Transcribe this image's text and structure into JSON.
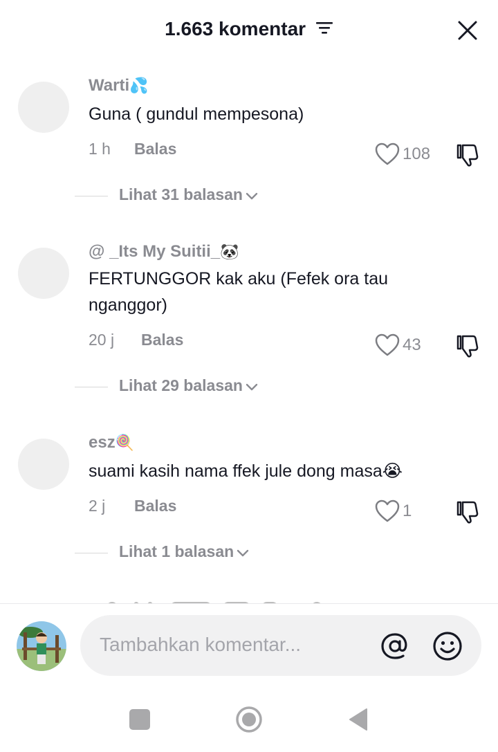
{
  "header": {
    "title": "1.663 komentar",
    "filter_icon": "filter-lines-icon",
    "close_icon": "close-x-icon"
  },
  "comments": [
    {
      "username": "Warti",
      "username_emoji": "💦",
      "text": "Guna ( gundul mempesona)",
      "time": "1 h",
      "reply_label": "Balas",
      "likes": "108",
      "view_replies": "Lihat 31 balasan"
    },
    {
      "username": "@ _Its My Suitii_",
      "username_emoji": "🐼",
      "text": "FERTUNGGOR kak aku (Fefek ora tau nganggor)",
      "time": "20 j",
      "reply_label": "Balas",
      "likes": "43",
      "view_replies": "Lihat 29 balasan"
    },
    {
      "username": "esz",
      "username_emoji": "🍭",
      "text": "suami kasih nama ffek jule dong masa😭",
      "time": "2 j",
      "reply_label": "Balas",
      "likes": "1",
      "view_replies": "Lihat 1 balasan"
    }
  ],
  "composer": {
    "placeholder": "Tambahkan komentar...",
    "mention_icon": "at-sign-icon",
    "emoji_icon": "smiley-icon"
  },
  "nav": {
    "recents_icon": "square-icon",
    "home_icon": "circle-icon",
    "back_icon": "triangle-back-icon"
  },
  "colors": {
    "primary_text": "#161823",
    "secondary_text": "#8a8b91",
    "input_bg": "#f1f1f2",
    "avatar_placeholder": "#efefef"
  }
}
